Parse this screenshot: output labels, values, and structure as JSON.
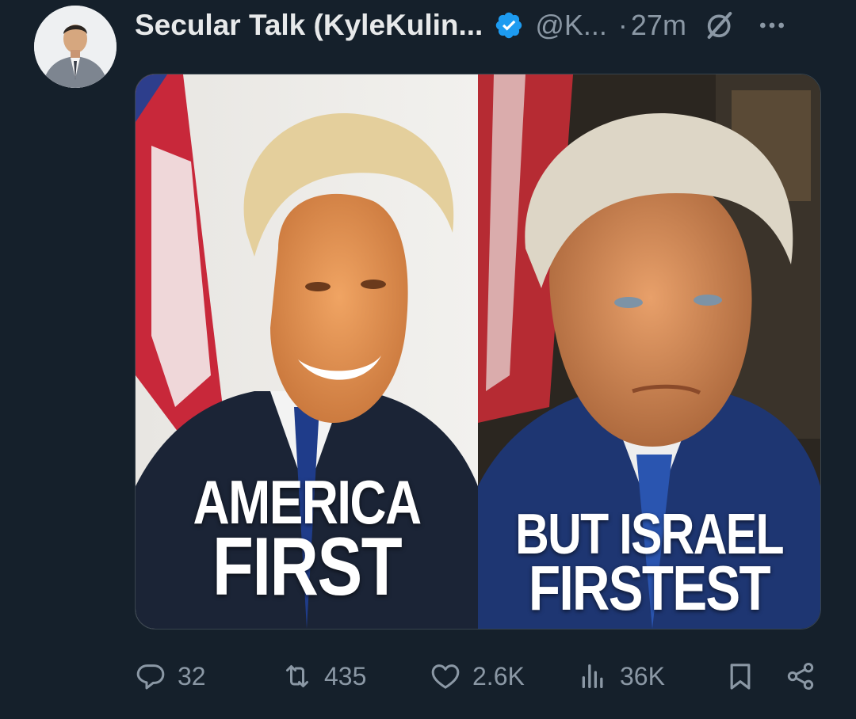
{
  "author": {
    "display_name": "Secular Talk (KyleKulin...",
    "handle": "@K...",
    "separator": "·",
    "time": "27m",
    "verified": true,
    "verified_color": "#1d9bf0"
  },
  "icons": {
    "verified": "verified-badge-icon",
    "grok": "grok-icon",
    "more": "more-options-icon",
    "reply": "reply-icon",
    "repost": "repost-icon",
    "like": "heart-icon",
    "views": "views-icon",
    "bookmark": "bookmark-icon",
    "share": "share-icon"
  },
  "media": {
    "left_panel": {
      "line1": "AMERICA",
      "line2": "FIRST"
    },
    "right_panel": {
      "line1": "BUT ISRAEL",
      "line2": "FIRSTEST"
    }
  },
  "actions": {
    "replies": "32",
    "reposts": "435",
    "likes": "2.6K",
    "views": "36K"
  },
  "colors": {
    "background": "#15202b",
    "text_primary": "#e7e9ea",
    "text_secondary": "#8b98a5",
    "border": "#38444d"
  }
}
